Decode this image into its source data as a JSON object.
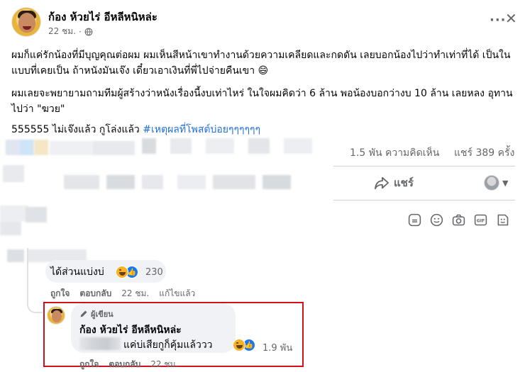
{
  "post": {
    "author": "ก้อง ห้วยไร่ อีหลีหนิหล่ะ",
    "time": "22 ชม.",
    "paragraph1": "ผมก็แค่รักน้องที่มีบุญคุณต่อผม ผมเห็นสีหน้าเขาทำงานด้วยความเคลียดและกดดัน เลยบอกน้องไปว่าทำเท่าที่ได้ เป็นในแบบที่เคยเป็น ถ้าหนังมันเจ๊ง เดี๋ยวเอาเงินที่พี่ไปจ่ายคืนเขา 😄",
    "paragraph2": "ผมเลยจะพยายามถามทีมผู้สร้างว่าหนังเรื่องนี้งบเท่าไหร่ ในใจผมคิดว่า 6 ล้าน พอน้องบอกว่างบ 10 ล้าน เลยหลง อุทานไปว่า \"ฆวย\"",
    "paragraph3_prefix": "555555 ไม่เจ๊งแล้ว กูโล่งแล้ว ",
    "hashtag": "#เหตุผลที่โพสต์บ่อยๆๆๆๆๆๆ",
    "comments_count": "1.5 พัน ความคิดเห็น",
    "shares_count": "แชร์ 389 ครั้ง",
    "share_label": "แชร์"
  },
  "comment1": {
    "text": "ได้ส่วนแบ่งบ่",
    "reaction_count": "230",
    "like_label": "ถูกใจ",
    "reply_label": "ตอบกลับ",
    "time": "22 ชม.",
    "edited_label": "แก้ไขแล้ว"
  },
  "reply": {
    "author_badge": "ผู้เขียน",
    "author": "ก้อง ห้วยไร่ อีหลีหนิหล่ะ",
    "text": "แค่บ่เสียกูก็คุ้มแล้ววว",
    "reaction_count": "1.9 พัน",
    "like_label": "ถูกใจ",
    "reply_label": "ตอบกลับ",
    "time": "22 ชม."
  },
  "colors": {
    "accent": "#216fdb",
    "highlight_border": "#d0121b",
    "bubble": "#f0f2f5",
    "muted_text": "#65676b"
  },
  "icons": [
    "globe-icon",
    "more-icon",
    "close-icon",
    "share-icon",
    "caret-icon",
    "sticker-icon",
    "emoji-icon",
    "camera-icon",
    "gif-icon",
    "stamp-icon",
    "haha-icon",
    "like-icon",
    "pen-icon"
  ]
}
